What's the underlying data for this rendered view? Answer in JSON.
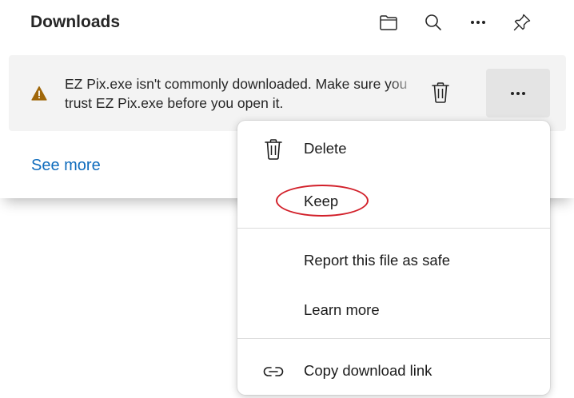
{
  "panel": {
    "title": "Downloads",
    "header_buttons": [
      {
        "icon": "folder-icon",
        "tooltip": "Open downloads folder"
      },
      {
        "icon": "search-icon",
        "tooltip": "Search downloads"
      },
      {
        "icon": "more-icon",
        "tooltip": "More options"
      },
      {
        "icon": "pin-icon",
        "tooltip": "Pin to toolbar"
      }
    ],
    "item": {
      "warning_icon": "warning-triangle-icon",
      "message_line1": "EZ Pix.exe isn't commonly downloaded. Make sure you",
      "message_line2": "trust EZ Pix.exe before you open it.",
      "delete_icon": "trash-icon",
      "more_icon": "more-icon"
    },
    "see_more": "See more"
  },
  "menu": {
    "items": [
      {
        "label": "Delete",
        "icon": "trash-icon"
      },
      {
        "label": "Keep",
        "icon": "",
        "highlighted": true
      },
      {
        "label": "Report this file as safe",
        "icon": ""
      },
      {
        "label": "Learn more",
        "icon": ""
      },
      {
        "label": "Copy download link",
        "icon": "link-icon"
      }
    ]
  },
  "colors": {
    "accent_link": "#0f6cbd",
    "warning": "#a0670a",
    "highlight_ring": "#d2202a",
    "item_background": "#f3f3f3"
  }
}
